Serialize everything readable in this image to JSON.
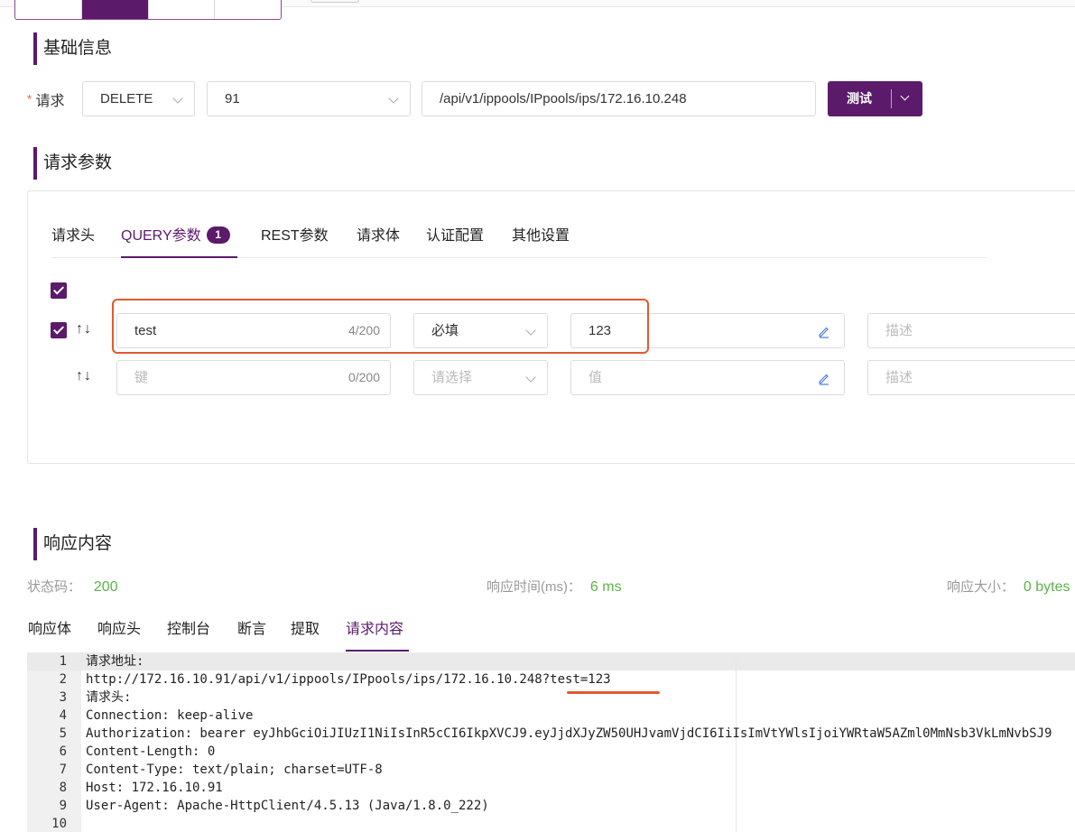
{
  "basic": {
    "title": "基础信息",
    "request_label": "请求",
    "required_mark": "*",
    "method": "DELETE",
    "environment": "91",
    "url": "/api/v1/ippools/IPpools/ips/172.16.10.248",
    "test_button": "测试"
  },
  "params": {
    "title": "请求参数",
    "tabs": [
      {
        "label": "请求头"
      },
      {
        "label": "QUERY参数",
        "badge": "1"
      },
      {
        "label": "REST参数"
      },
      {
        "label": "请求体"
      },
      {
        "label": "认证配置"
      },
      {
        "label": "其他设置"
      }
    ],
    "rows": [
      {
        "key": "test",
        "count": "4/200",
        "required": "必填",
        "value": "123",
        "description_placeholder": "描述"
      },
      {
        "key_placeholder": "键",
        "count": "0/200",
        "required_placeholder": "请选择",
        "value_placeholder": "值",
        "description_placeholder": "描述"
      }
    ]
  },
  "response": {
    "title": "响应内容",
    "status_label": "状态码：",
    "status_value": "200",
    "time_label": "响应时间(ms)：",
    "time_value": "6 ms",
    "size_label": "响应大小：",
    "size_value": "0 bytes",
    "tabs": [
      {
        "label": "响应体"
      },
      {
        "label": "响应头"
      },
      {
        "label": "控制台"
      },
      {
        "label": "断言"
      },
      {
        "label": "提取"
      },
      {
        "label": "请求内容"
      }
    ],
    "code_lines": [
      {
        "n": "1",
        "text": "请求地址:"
      },
      {
        "n": "2",
        "text": "http://172.16.10.91/api/v1/ippools/IPpools/ips/172.16.10.248?test=123"
      },
      {
        "n": "3",
        "text": "请求头:"
      },
      {
        "n": "4",
        "text": "Connection: keep-alive"
      },
      {
        "n": "5",
        "text": "Authorization: bearer eyJhbGciOiJIUzI1NiIsInR5cCI6IkpXVCJ9.eyJjdXJyZW50UHJvamVjdCI6IiIsImVtYWlsIjoiYWRtaW5AZml0MmNsb3VkLmNvbSJ9"
      },
      {
        "n": "6",
        "text": "Content-Length: 0"
      },
      {
        "n": "7",
        "text": "Content-Type: text/plain; charset=UTF-8"
      },
      {
        "n": "8",
        "text": "Host: 172.16.10.91"
      },
      {
        "n": "9",
        "text": "User-Agent: Apache-HttpClient/4.5.13 (Java/1.8.0_222)"
      },
      {
        "n": "10",
        "text": ""
      }
    ]
  },
  "colors": {
    "accent": "#5c1a6b",
    "highlight": "#e25a2e",
    "success": "#5bb34a"
  }
}
